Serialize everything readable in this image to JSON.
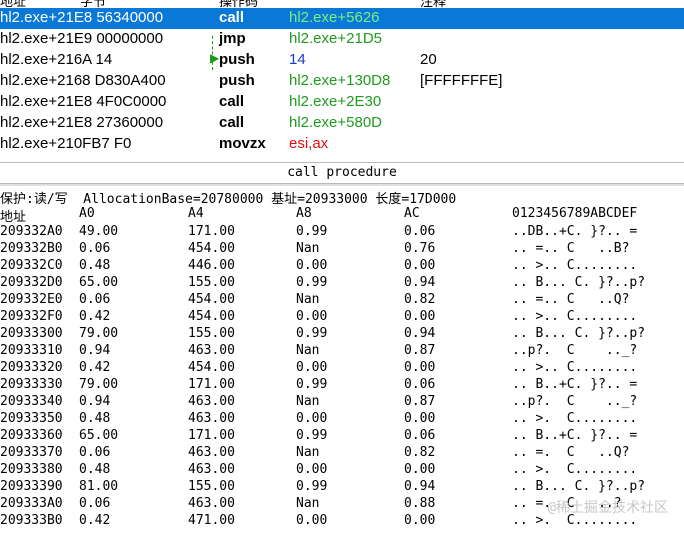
{
  "disasm": {
    "columns": [
      "地址",
      "字节",
      "操作码",
      "注释"
    ],
    "rows": [
      {
        "addr": "hl2.exe+21E8 56340000",
        "mnemonic": "call",
        "operand": "hl2.exe+5626",
        "comment": "",
        "selected": true
      },
      {
        "addr": "hl2.exe+21E9 00000000",
        "mnemonic": "jmp",
        "operand": "hl2.exe+21D5",
        "comment": ""
      },
      {
        "addr": "hl2.exe+216A 14",
        "mnemonic": "push",
        "operand": "14",
        "comment": "20"
      },
      {
        "addr": "hl2.exe+2168 D830A400",
        "mnemonic": "push",
        "operand": "hl2.exe+130D8",
        "comment": "[FFFFFFFE]"
      },
      {
        "addr": "hl2.exe+21E8 4F0C0000",
        "mnemonic": "call",
        "operand": "hl2.exe+2E30",
        "comment": ""
      },
      {
        "addr": "hl2.exe+21E8 27360000",
        "mnemonic": "call",
        "operand": "hl2.exe+580D",
        "comment": ""
      },
      {
        "addr": "hl2.exe+210FB7 F0",
        "mnemonic": "movzx",
        "operand": "esi,ax",
        "comment": ""
      }
    ]
  },
  "status": "call procedure",
  "dump": {
    "info": "保护:读/写  AllocationBase=20780000 基址=20933000 长度=17D000",
    "headers": {
      "addr": "地址",
      "a0": "A0",
      "a4": "A4",
      "a8": "A8",
      "ac": "AC",
      "ascii": "0123456789ABCDEF"
    },
    "rows": [
      {
        "addr": "209332A0",
        "a0": "49.00",
        "a4": "171.00",
        "a8": "0.99",
        "ac": "0.06",
        "ascii": "..DB..+C. }?.. ="
      },
      {
        "addr": "209332B0",
        "a0": "0.06",
        "a4": "454.00",
        "a8": "Nan",
        "ac": "0.76",
        "ascii": ".. =.. C   ..B?"
      },
      {
        "addr": "209332C0",
        "a0": "0.48",
        "a4": "446.00",
        "a8": "0.00",
        "ac": "0.00",
        "ascii": ".. >.. C........"
      },
      {
        "addr": "209332D0",
        "a0": "65.00",
        "a4": "155.00",
        "a8": "0.99",
        "ac": "0.94",
        "ascii": ".. B... C. }?..p?"
      },
      {
        "addr": "209332E0",
        "a0": "0.06",
        "a4": "454.00",
        "a8": "Nan",
        "ac": "0.82",
        "ascii": ".. =.. C   ..Q?"
      },
      {
        "addr": "209332F0",
        "a0": "0.42",
        "a4": "454.00",
        "a8": "0.00",
        "ac": "0.00",
        "ascii": ".. >.. C........"
      },
      {
        "addr": "20933300",
        "a0": "79.00",
        "a4": "155.00",
        "a8": "0.99",
        "ac": "0.94",
        "ascii": ".. B... C. }?..p?"
      },
      {
        "addr": "20933310",
        "a0": "0.94",
        "a4": "463.00",
        "a8": "Nan",
        "ac": "0.87",
        "ascii": "..p?.  C    .._?"
      },
      {
        "addr": "20933320",
        "a0": "0.42",
        "a4": "454.00",
        "a8": "0.00",
        "ac": "0.00",
        "ascii": ".. >.. C........"
      },
      {
        "addr": "20933330",
        "a0": "79.00",
        "a4": "171.00",
        "a8": "0.99",
        "ac": "0.06",
        "ascii": ".. B..+C. }?.. ="
      },
      {
        "addr": "20933340",
        "a0": "0.94",
        "a4": "463.00",
        "a8": "Nan",
        "ac": "0.87",
        "ascii": "..p?.  C    .._?"
      },
      {
        "addr": "20933350",
        "a0": "0.48",
        "a4": "463.00",
        "a8": "0.00",
        "ac": "0.00",
        "ascii": ".. >.  C........"
      },
      {
        "addr": "20933360",
        "a0": "65.00",
        "a4": "171.00",
        "a8": "0.99",
        "ac": "0.06",
        "ascii": ".. B..+C. }?.. ="
      },
      {
        "addr": "20933370",
        "a0": "0.06",
        "a4": "463.00",
        "a8": "Nan",
        "ac": "0.82",
        "ascii": ".. =.  C   ..Q?"
      },
      {
        "addr": "20933380",
        "a0": "0.48",
        "a4": "463.00",
        "a8": "0.00",
        "ac": "0.00",
        "ascii": ".. >.  C........"
      },
      {
        "addr": "20933390",
        "a0": "81.00",
        "a4": "155.00",
        "a8": "0.99",
        "ac": "0.94",
        "ascii": ".. B... C. }?..p?"
      },
      {
        "addr": "209333A0",
        "a0": "0.06",
        "a4": "463.00",
        "a8": "Nan",
        "ac": "0.88",
        "ascii": ".. =.  C   ..?"
      },
      {
        "addr": "209333B0",
        "a0": "0.42",
        "a4": "471.00",
        "a8": "0.00",
        "ac": "0.00",
        "ascii": ".. >.  C........"
      }
    ]
  },
  "watermark": "@稀土掘金技术社区"
}
